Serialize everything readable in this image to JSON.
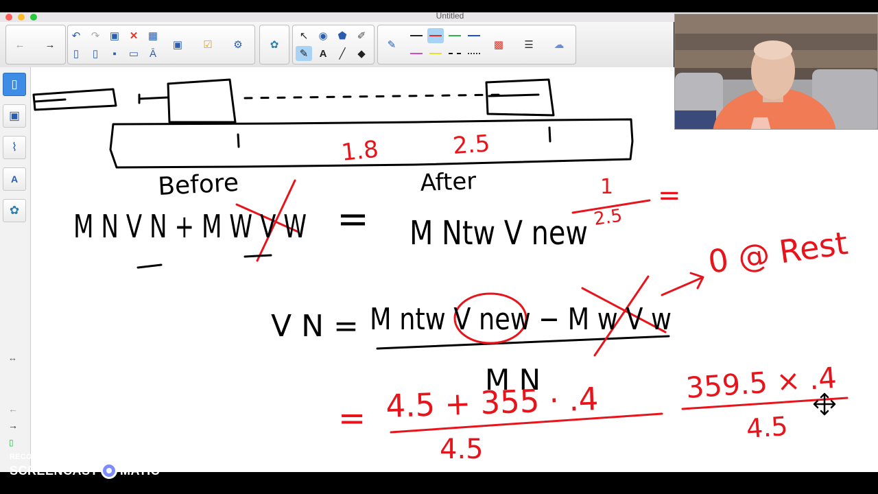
{
  "window": {
    "title": "Untitled",
    "traffic_colors": [
      "#fc5f57",
      "#fdbc2e",
      "#28c840"
    ]
  },
  "toolbar": {
    "icons": [
      "back-arrow-icon",
      "forward-arrow-icon",
      "undo-icon",
      "redo-icon",
      "paste-icon",
      "delete-icon",
      "table-icon",
      "new-page-icon",
      "page-icon",
      "save-icon",
      "screen-shade-icon",
      "view-screens-icon",
      "capture-icon",
      "check-icon",
      "add-on-icon",
      "measurement-tool-icon",
      "select-arrow-icon",
      "shapes-icon",
      "fill-icon",
      "eraser-icon",
      "text-icon",
      "line-icon",
      "pen-icon",
      "color-palette-icon",
      "line-style-icon",
      "properties-icon"
    ],
    "pen_colors": [
      "#222222",
      "#e8261f",
      "#2db34a",
      "#1a4fd6",
      "#d14bd1",
      "#e3e32b",
      "#111111"
    ]
  },
  "sidebar": {
    "items": [
      "page-sorter-icon",
      "gallery-icon",
      "attachments-icon",
      "properties-icon",
      "add-ons-icon"
    ],
    "expand_label": "↔"
  },
  "board": {
    "label_before": "Before",
    "label_after": "After",
    "tick_one": "1",
    "tick_one_b": "1",
    "red_1_8": "1.8",
    "red_2_5": "2.5",
    "eq_lhs": "M N V N + M W V W",
    "eq_rhs": "M Ntw V new",
    "red_fraction_num": "1",
    "red_fraction_den": "2.5",
    "red_equals": "=",
    "vn_lhs": "V N =",
    "vn_numer": "M ntw V new − M w V w",
    "vn_denom": "M N",
    "zero_at_rest": "0 @ Rest",
    "calc_numer": "4.5 + 355 · .4",
    "calc_denom": "4.5",
    "calc_eq": "=",
    "right_numer": "359.5 × .4",
    "right_denom": "4.5"
  },
  "watermark": {
    "line1": "RECORDED WITH",
    "line2a": "SCREENCAST",
    "line2b": "MATIC"
  },
  "colors": {
    "ink": "#000000",
    "red_ink": "#e8141c",
    "accent": "#3e8ce6"
  }
}
